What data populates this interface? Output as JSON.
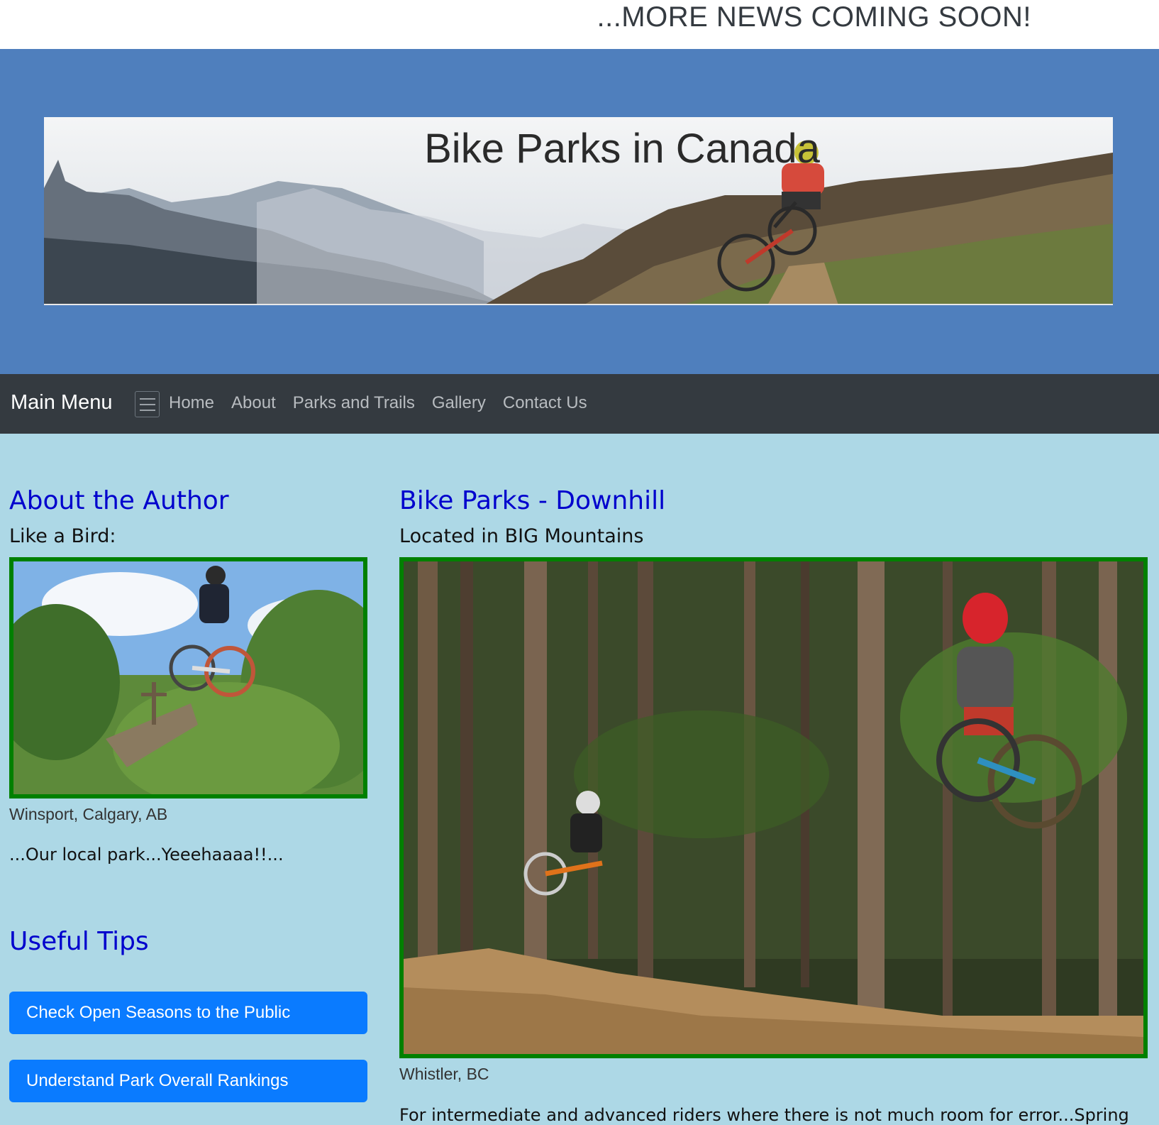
{
  "news_ticker": "...MORE NEWS COMING SOON!",
  "banner": {
    "title": "Bike Parks in Canada"
  },
  "navbar": {
    "brand": "Main Menu",
    "links": [
      "Home",
      "About",
      "Parks and Trails",
      "Gallery",
      "Contact Us"
    ]
  },
  "left": {
    "heading": "About the Author",
    "subheading": "Like a Bird:",
    "caption": "Winsport, Calgary, AB",
    "text": "...Our local park...Yeeehaaaa!!...",
    "tips_heading": "Useful Tips",
    "buttons": [
      "Check Open Seasons to the Public",
      "Understand Park Overall Rankings"
    ]
  },
  "right": {
    "heading": "Bike Parks - Downhill",
    "subheading": "Located in BIG Mountains",
    "caption": "Whistler, BC",
    "text": "For intermediate and advanced riders where there is not much room for error...Spring"
  },
  "colors": {
    "banner_bg": "#4f7fbd",
    "page_bg": "#add8e6",
    "heading": "#0000cd",
    "button": "#0a7bff",
    "photo_border": "#008000"
  }
}
